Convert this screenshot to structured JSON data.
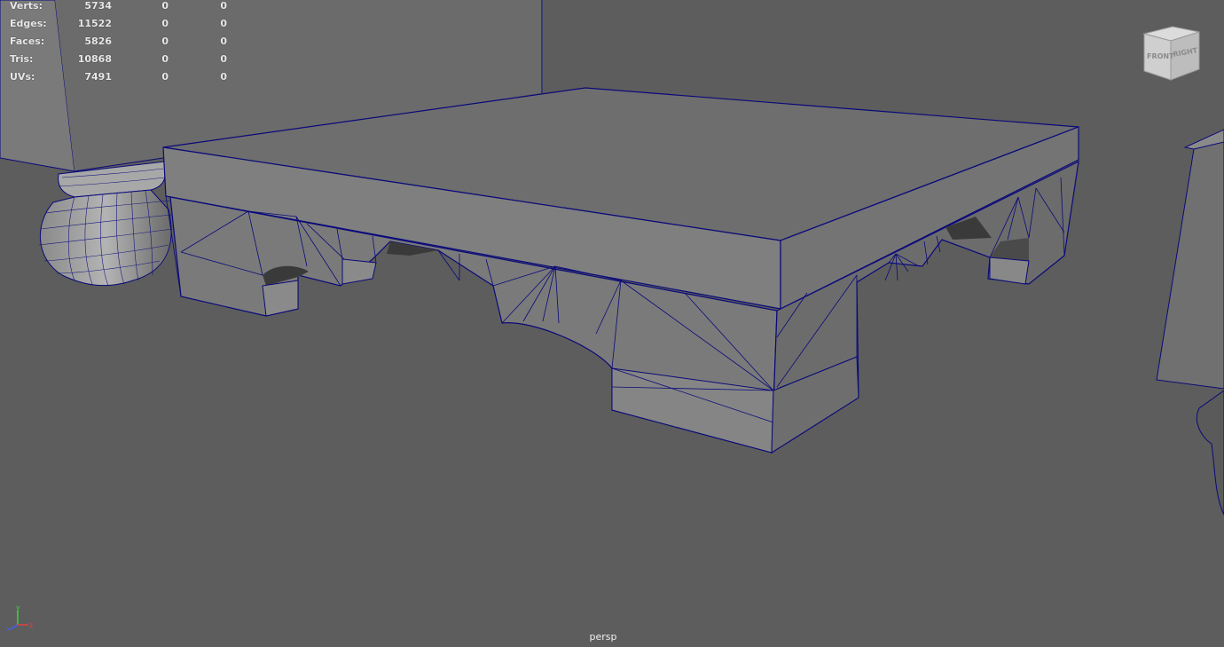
{
  "viewport": {
    "camera": "persp",
    "background": "#5d5d5d",
    "wireframe_color": "#0a0a7a"
  },
  "heads_up_display": {
    "rows": [
      {
        "label": "Verts:",
        "v1": "5734",
        "v2": "0",
        "v3": "0"
      },
      {
        "label": "Edges:",
        "v1": "11522",
        "v2": "0",
        "v3": "0"
      },
      {
        "label": "Faces:",
        "v1": "5826",
        "v2": "0",
        "v3": "0"
      },
      {
        "label": "Tris:",
        "v1": "10868",
        "v2": "0",
        "v3": "0"
      },
      {
        "label": "UVs:",
        "v1": "7491",
        "v2": "0",
        "v3": "0"
      }
    ]
  },
  "view_cube": {
    "front_label": "FRONT",
    "right_label": "RIGHT"
  },
  "axis_gizmo": {
    "x_label": "x",
    "y_label": "y",
    "z_label": "z",
    "x_color": "#e04040",
    "y_color": "#40d040",
    "z_color": "#4060ff"
  }
}
